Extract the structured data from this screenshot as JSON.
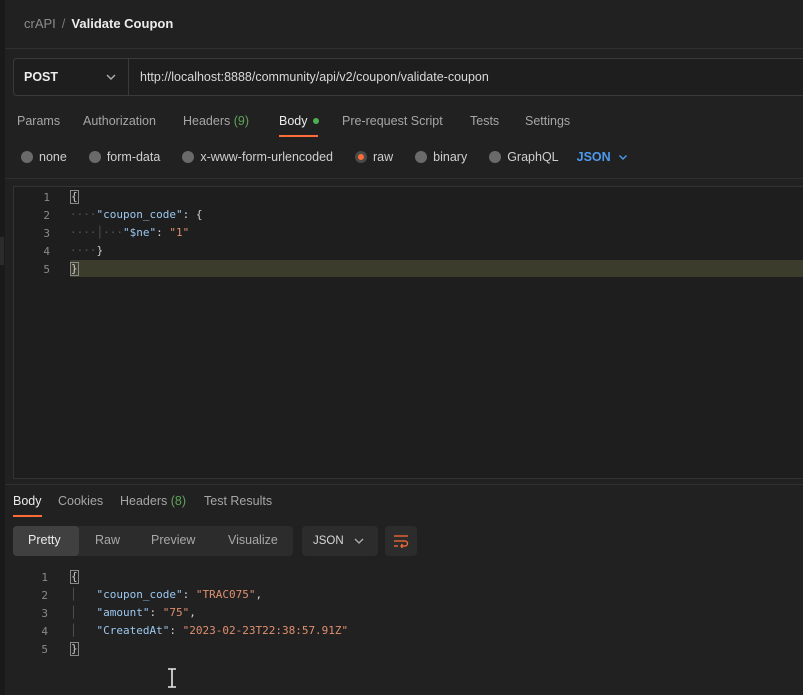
{
  "breadcrumb": {
    "collection": "crAPI",
    "separator": "/",
    "request": "Validate Coupon"
  },
  "request": {
    "method": "POST",
    "url": "http://localhost:8888/community/api/v2/coupon/validate-coupon"
  },
  "request_tabs": [
    {
      "label": "Params"
    },
    {
      "label": "Authorization"
    },
    {
      "label": "Headers",
      "count": "(9)"
    },
    {
      "label": "Body",
      "active": true,
      "indicator": "green-dot"
    },
    {
      "label": "Pre-request Script"
    },
    {
      "label": "Tests"
    },
    {
      "label": "Settings"
    }
  ],
  "body_types": [
    "none",
    "form-data",
    "x-www-form-urlencoded",
    "raw",
    "binary",
    "GraphQL"
  ],
  "body_type_selected": "raw",
  "body_format": "JSON",
  "request_body_lines": [
    {
      "n": "1",
      "text": "{"
    },
    {
      "n": "2",
      "key": "\"coupon_code\"",
      "rest": ": {"
    },
    {
      "n": "3",
      "key": "\"$ne\"",
      "sep": ": ",
      "value": "\"1\""
    },
    {
      "n": "4",
      "text": "}"
    },
    {
      "n": "5",
      "text": "}"
    }
  ],
  "response_tabs": [
    {
      "label": "Body",
      "active": true
    },
    {
      "label": "Cookies"
    },
    {
      "label": "Headers",
      "count": "(8)"
    },
    {
      "label": "Test Results"
    }
  ],
  "response_views": [
    "Pretty",
    "Raw",
    "Preview",
    "Visualize"
  ],
  "response_view_selected": "Pretty",
  "response_format": "JSON",
  "response_body_lines": [
    {
      "n": "1",
      "text": "{"
    },
    {
      "n": "2",
      "key": "\"coupon_code\"",
      "sep": ": ",
      "value": "\"TRAC075\"",
      "tail": ","
    },
    {
      "n": "3",
      "key": "\"amount\"",
      "sep": ": ",
      "value": "\"75\"",
      "tail": ","
    },
    {
      "n": "4",
      "key": "\"CreatedAt\"",
      "sep": ": ",
      "value": "\"2023-02-23T22:38:57.91Z\""
    },
    {
      "n": "5",
      "text": "}"
    }
  ],
  "colors": {
    "accent": "#ff6c37",
    "link": "#4c9aed",
    "count": "#5fa35c",
    "json_key": "#9cc8f0",
    "json_string": "#e09070"
  },
  "icons": {
    "method_dropdown": "chevron-down-icon",
    "format_dropdown": "chevron-down-icon",
    "wrap": "wrap-lines-icon",
    "cursor": "text-cursor-icon"
  }
}
